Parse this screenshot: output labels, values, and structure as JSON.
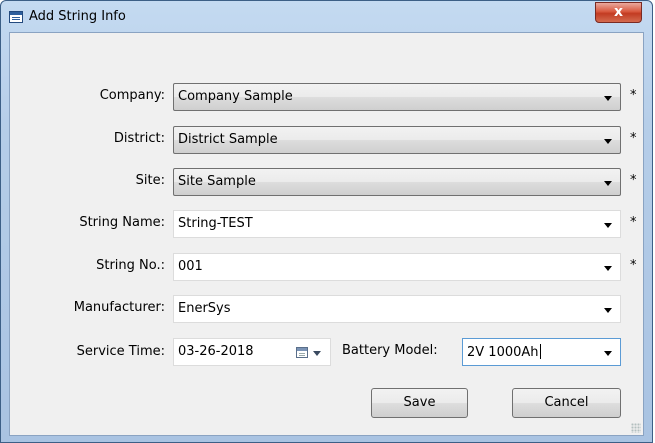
{
  "window": {
    "title": "Add String Info",
    "close_glyph": "x"
  },
  "fields": [
    {
      "label": "Company:",
      "value": "Company Sample",
      "required": "*"
    },
    {
      "label": "District:",
      "value": "District Sample",
      "required": "*"
    },
    {
      "label": "Site:",
      "value": "Site Sample",
      "required": "*"
    },
    {
      "label": "String Name:",
      "value": "String-TEST",
      "required": "*"
    },
    {
      "label": "String No.:",
      "value": "001",
      "required": "*"
    },
    {
      "label": "Manufacturer:",
      "value": "EnerSys",
      "required": ""
    }
  ],
  "service_time": {
    "label": "Service Time:",
    "value": "03-26-2018"
  },
  "battery_model": {
    "label": "Battery Model:",
    "value": "2V 1000Ah"
  },
  "buttons": {
    "save": "Save",
    "cancel": "Cancel"
  },
  "icons": {
    "window": "window-form-icon",
    "date": "calendar-icon",
    "dropdown": "chevron-down-icon"
  }
}
